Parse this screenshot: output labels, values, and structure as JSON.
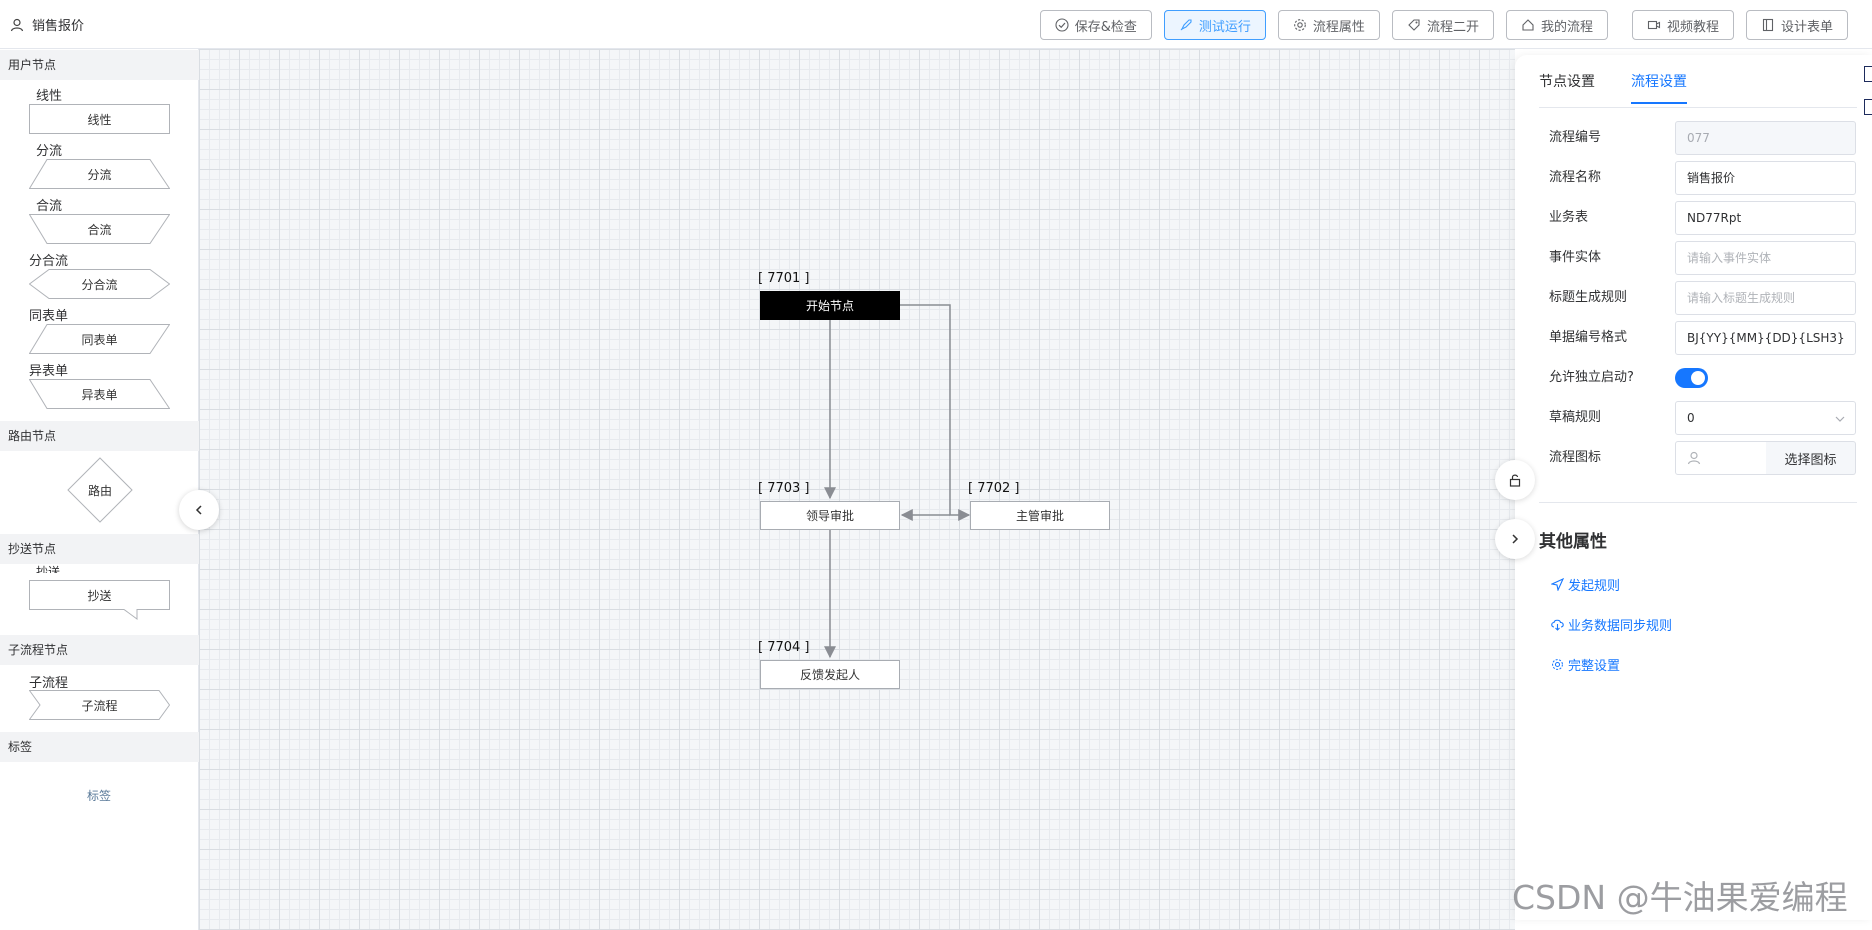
{
  "header": {
    "title": "销售报价",
    "buttons": {
      "save": "保存&检查",
      "test_run": "测试运行",
      "flow_props": "流程属性",
      "flow_dev": "流程二开",
      "my_flows": "我的流程",
      "video_tutorial": "视频教程",
      "design_form": "设计表单"
    }
  },
  "palette": {
    "user_nodes": {
      "title": "用户节点",
      "items": [
        {
          "label": "线性",
          "shape": "线性"
        },
        {
          "label": "分流",
          "shape": "分流"
        },
        {
          "label": "合流",
          "shape": "合流"
        },
        {
          "label": "分合流",
          "shape": "分合流"
        },
        {
          "label": "同表单",
          "shape": "同表单"
        },
        {
          "label": "异表单",
          "shape": "异表单"
        }
      ]
    },
    "route_nodes": {
      "title": "路由节点",
      "shape": "路由"
    },
    "cc_nodes": {
      "title": "抄送节点",
      "label": "抄送",
      "shape": "抄送"
    },
    "subflow_nodes": {
      "title": "子流程节点",
      "label": "子流程",
      "shape": "子流程"
    },
    "tags": {
      "title": "标签",
      "shape": "标签"
    }
  },
  "canvas": {
    "nodes": [
      {
        "id": "[ 7701 ]",
        "label": "开始节点"
      },
      {
        "id": "[ 7703 ]",
        "label": "领导审批"
      },
      {
        "id": "[ 7702 ]",
        "label": "主管审批"
      },
      {
        "id": "[ 7704 ]",
        "label": "反馈发起人"
      }
    ]
  },
  "panel": {
    "tabs": [
      "节点设置",
      "流程设置"
    ],
    "active_tab": "流程设置",
    "fields": {
      "flow_no": {
        "label": "流程编号",
        "value": "077"
      },
      "flow_name": {
        "label": "流程名称",
        "value": "销售报价"
      },
      "biz_table": {
        "label": "业务表",
        "value": "ND77Rpt"
      },
      "event_entity": {
        "label": "事件实体",
        "placeholder": "请输入事件实体"
      },
      "title_rule": {
        "label": "标题生成规则",
        "placeholder": "请输入标题生成规则"
      },
      "bill_no_format": {
        "label": "单据编号格式",
        "value": "BJ{YY}{MM}{DD}{LSH3}"
      },
      "allow_start": {
        "label": "允许独立启动?",
        "enabled": true
      },
      "draft_rule": {
        "label": "草稿规则",
        "value": "0"
      },
      "flow_icon": {
        "label": "流程图标",
        "button": "选择图标"
      }
    },
    "other": {
      "title": "其他属性",
      "links": [
        "发起规则",
        "业务数据同步规则",
        "完整设置"
      ]
    }
  },
  "watermark": "CSDN @牛油果爱编程",
  "colors": {
    "accent": "#1677ff",
    "start_node": "#000000",
    "grid_bg": "#f4f6f8"
  }
}
